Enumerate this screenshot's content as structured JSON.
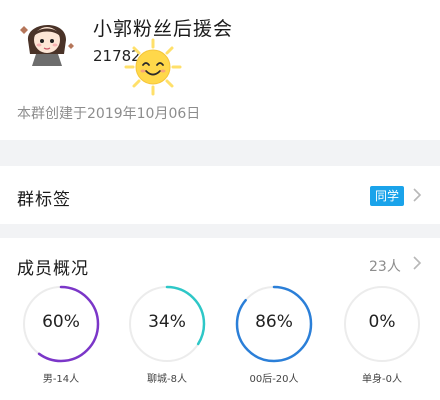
{
  "group": {
    "name": "小郭粉丝后援会",
    "id_partial": "21782",
    "created": "本群创建于2019年10月06日"
  },
  "tags": {
    "label": "群标签",
    "badge": "同学",
    "badge_color": "#1aa3ea"
  },
  "members": {
    "label": "成员概况",
    "count": "23人",
    "stats": [
      {
        "percent_text": "60%",
        "value": 0.6,
        "label": "男-14人",
        "color": "#7b36c8"
      },
      {
        "percent_text": "34%",
        "value": 0.34,
        "label": "聊城-8人",
        "color": "#2ec7c7"
      },
      {
        "percent_text": "86%",
        "value": 0.86,
        "label": "00后-20人",
        "color": "#2b7fd8"
      },
      {
        "percent_text": "0%",
        "value": 0.0,
        "label": "单身-0人",
        "color": "#cccccc"
      }
    ]
  },
  "icons": {
    "avatar": "cartoon-avatar-icon",
    "overlay": "sun-sticker-icon",
    "chevron": "chevron-right-icon"
  }
}
